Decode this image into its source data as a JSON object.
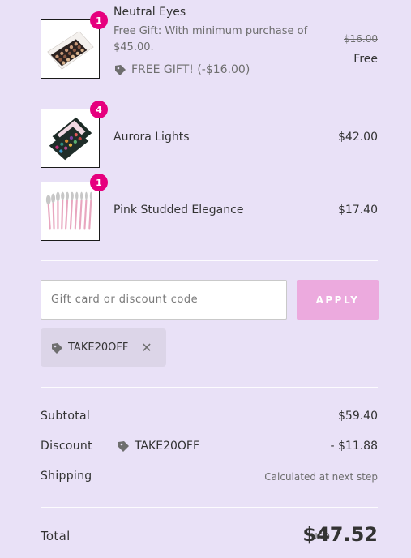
{
  "items": [
    {
      "name": "Neutral Eyes",
      "qty": "1",
      "subtitle": "Free Gift: With minimum purchase of $45.00.",
      "gift_label": "FREE GIFT! (-$16.00)",
      "original_price": "$16.00",
      "price": "Free"
    },
    {
      "name": "Aurora Lights",
      "qty": "4",
      "price": "$42.00"
    },
    {
      "name": "Pink Studded Elegance",
      "qty": "1",
      "price": "$17.40"
    }
  ],
  "discount": {
    "placeholder": "Gift card or discount code",
    "apply_label": "APPLY",
    "applied_code": "TAKE20OFF",
    "remove_icon": "close-icon"
  },
  "summary": {
    "subtotal_label": "Subtotal",
    "subtotal_value": "$59.40",
    "discount_label": "Discount",
    "discount_code": "TAKE20OFF",
    "discount_value": "- $11.88",
    "shipping_label": "Shipping",
    "shipping_value": "Calculated at next step",
    "total_label": "Total",
    "currency": "USD",
    "total_value": "$47.52"
  },
  "colors": {
    "background": "#e9e1f7",
    "badge": "#e6007e",
    "apply_button": "#ecaade",
    "chip": "#dcd5e8"
  }
}
